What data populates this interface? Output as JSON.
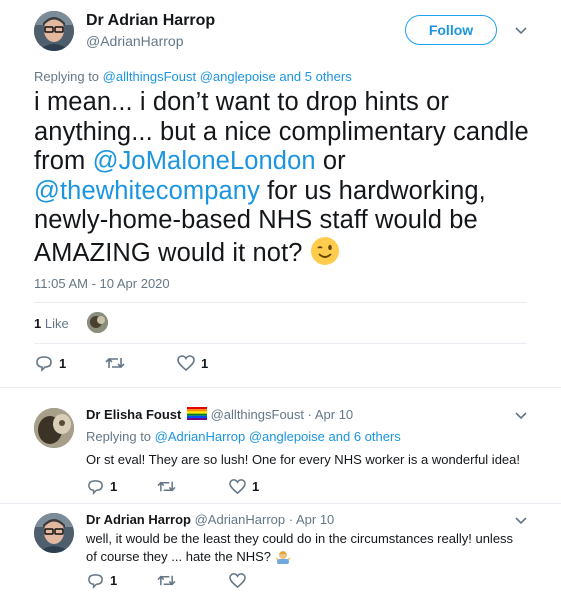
{
  "main_tweet": {
    "author_name": "Dr Adrian Harrop",
    "handle": "@AdrianHarrop",
    "follow_label": "Follow",
    "replying_prefix": "Replying to",
    "replying_user1": "@allthingsFoust",
    "replying_user2": "@anglepoise",
    "replying_suffix": "and 5 others",
    "text_1": "i mean... i don’t want to drop hints or anything... but a nice complimentary candle from ",
    "mention_1": "@JoMaloneLondon",
    "text_2": " or ",
    "mention_2": "@thewhitecompany",
    "text_3": " for us hardworking, newly-home-based NHS staff would be AMAZING would it not? ",
    "timestamp": "11:05 AM - 10 Apr 2020",
    "likes_count": "1",
    "likes_label": "Like",
    "reply_count": "1",
    "like_count": "1"
  },
  "replies": [
    {
      "author_name": "Dr Elisha Foust",
      "handle": "@allthingsFoust",
      "date": "· Apr 10",
      "replying_prefix": "Replying to",
      "replying_user1": "@AdrianHarrop",
      "replying_user2": "@anglepoise",
      "replying_suffix": "and 6 others",
      "text": "Or st eval!  They are so lush!  One for every NHS worker is a wonderful idea!",
      "reply_count": "1",
      "like_count": "1"
    },
    {
      "author_name": "Dr Adrian Harrop",
      "handle": "@AdrianHarrop",
      "date": "· Apr 10",
      "text": "well, it would be the least they could do in the circumstances really! unless of course they ... hate the NHS? ",
      "reply_count": "1"
    }
  ],
  "icons": [
    "reply-icon",
    "retweet-icon",
    "heart-icon",
    "chevron-down-icon",
    "wink-emoji-icon",
    "rainbow-flag-icon",
    "shrug-emoji-icon"
  ],
  "colors": {
    "link": "#1b95e0",
    "muted": "#657786",
    "text": "#14171a",
    "border": "#e6ecf0",
    "like_red": "#e0245e"
  }
}
